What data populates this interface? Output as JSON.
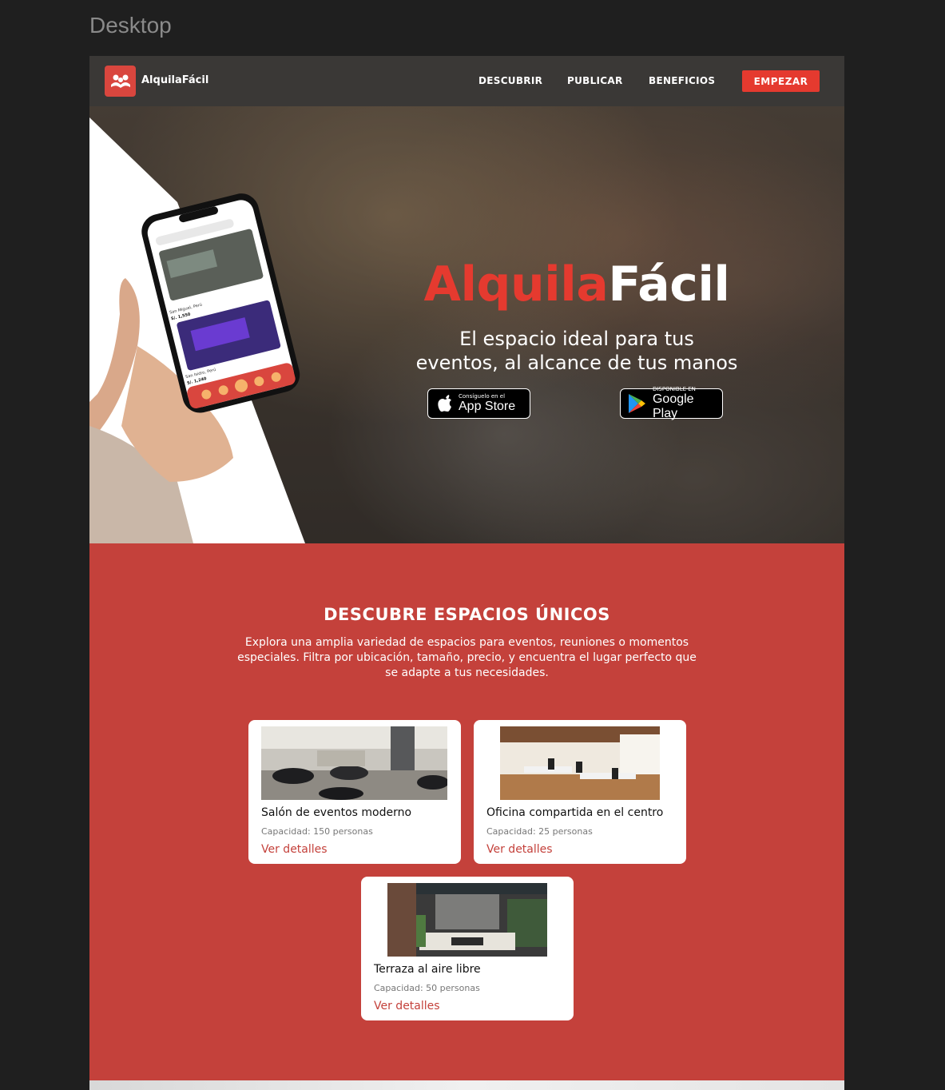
{
  "canvas": {
    "label": "Desktop"
  },
  "nav": {
    "brand": "AlquilaFácil",
    "links": [
      "DESCUBRIR",
      "PUBLICAR",
      "BENEFICIOS"
    ],
    "cta": "EMPEZAR"
  },
  "hero": {
    "title_red": "Alquila",
    "title_white": "Fácil",
    "subtitle_line1": "El espacio ideal para tus",
    "subtitle_line2": "eventos, al alcance de tus manos",
    "appstore_small": "Consíguelo en el",
    "appstore_big": "App Store",
    "googleplay_small": "DISPONIBLE EN",
    "googleplay_big": "Google Play"
  },
  "phone": {
    "listing1_location": "San Miguel, Perú",
    "listing1_price": "S/. 1,550",
    "listing2_location": "San Isidro, Perú",
    "listing2_price": "S/. 1,240"
  },
  "discover": {
    "title": "DESCUBRE ESPACIOS ÚNICOS",
    "description": "Explora una amplia variedad de espacios para eventos, reuniones o momentos especiales. Filtra por ubicación, tamaño, precio, y encuentra el lugar perfecto que se adapte a tus necesidades.",
    "cards": [
      {
        "title": "Salón de eventos moderno",
        "capacity": "Capacidad: 150 personas",
        "link": "Ver detalles"
      },
      {
        "title": "Oficina compartida en el centro",
        "capacity": "Capacidad: 25 personas",
        "link": "Ver detalles"
      },
      {
        "title": "Terraza al aire libre",
        "capacity": "Capacidad: 50 personas",
        "link": "Ver detalles"
      }
    ]
  },
  "colors": {
    "brand_red": "#c4413b",
    "accent_red": "#e53a2f",
    "nav_bg": "#3a3836"
  }
}
